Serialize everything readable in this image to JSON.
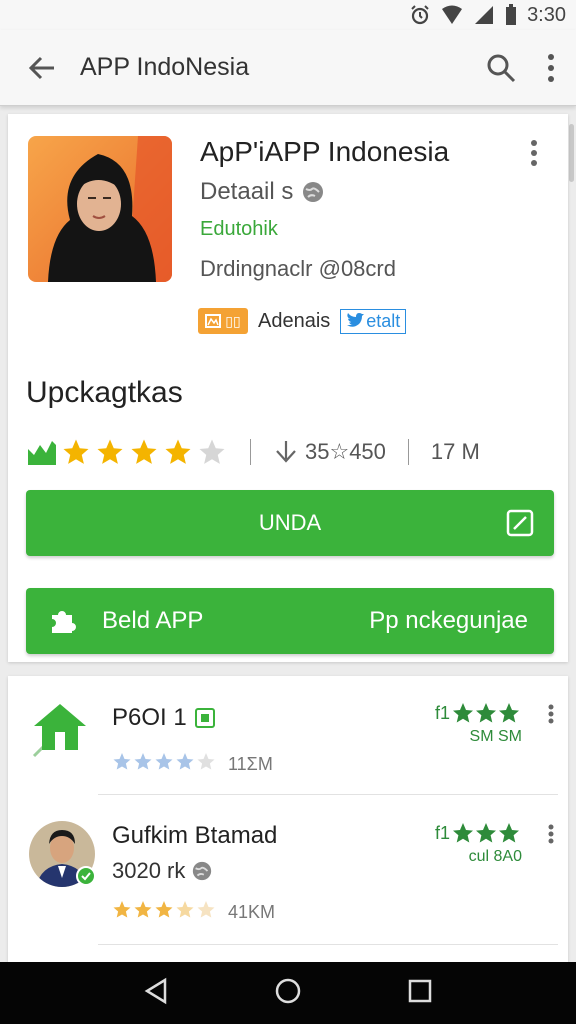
{
  "status": {
    "time": "3:30"
  },
  "appbar": {
    "title": "APP IndoNesia"
  },
  "app": {
    "name": "ApP'iAPP Indonesia",
    "details": "Detaail s",
    "green_text": "Edutohik",
    "developer": "Drdingnaclr @08crd",
    "badge_label": "Adenais",
    "twitter_label": "etalt"
  },
  "section": {
    "heading": "Upckagtkas"
  },
  "rating": {
    "stars": 4,
    "downloads": "35☆450",
    "size": "17 M"
  },
  "buttons": {
    "install_label": "UNDA",
    "buy_label": "Beld APP",
    "buy_right_label": "Pp nckegunjae"
  },
  "list": [
    {
      "title": "P6OI 1",
      "size": "11ΣM",
      "right_line": "f1",
      "right_sub": "SM SM",
      "stars": 3,
      "user_stars": 4
    },
    {
      "title": "Gufkim Btamad",
      "subtitle": "3020 rk",
      "size": "41KM",
      "right_line": "f1",
      "right_sub": "cul 8A0",
      "stars": 3,
      "user_stars": 3
    }
  ],
  "colors": {
    "green": "#3bb33b",
    "star_gold": "#f4b400",
    "star_blue": "#a8c4e8",
    "nav_bar": "#050505"
  }
}
